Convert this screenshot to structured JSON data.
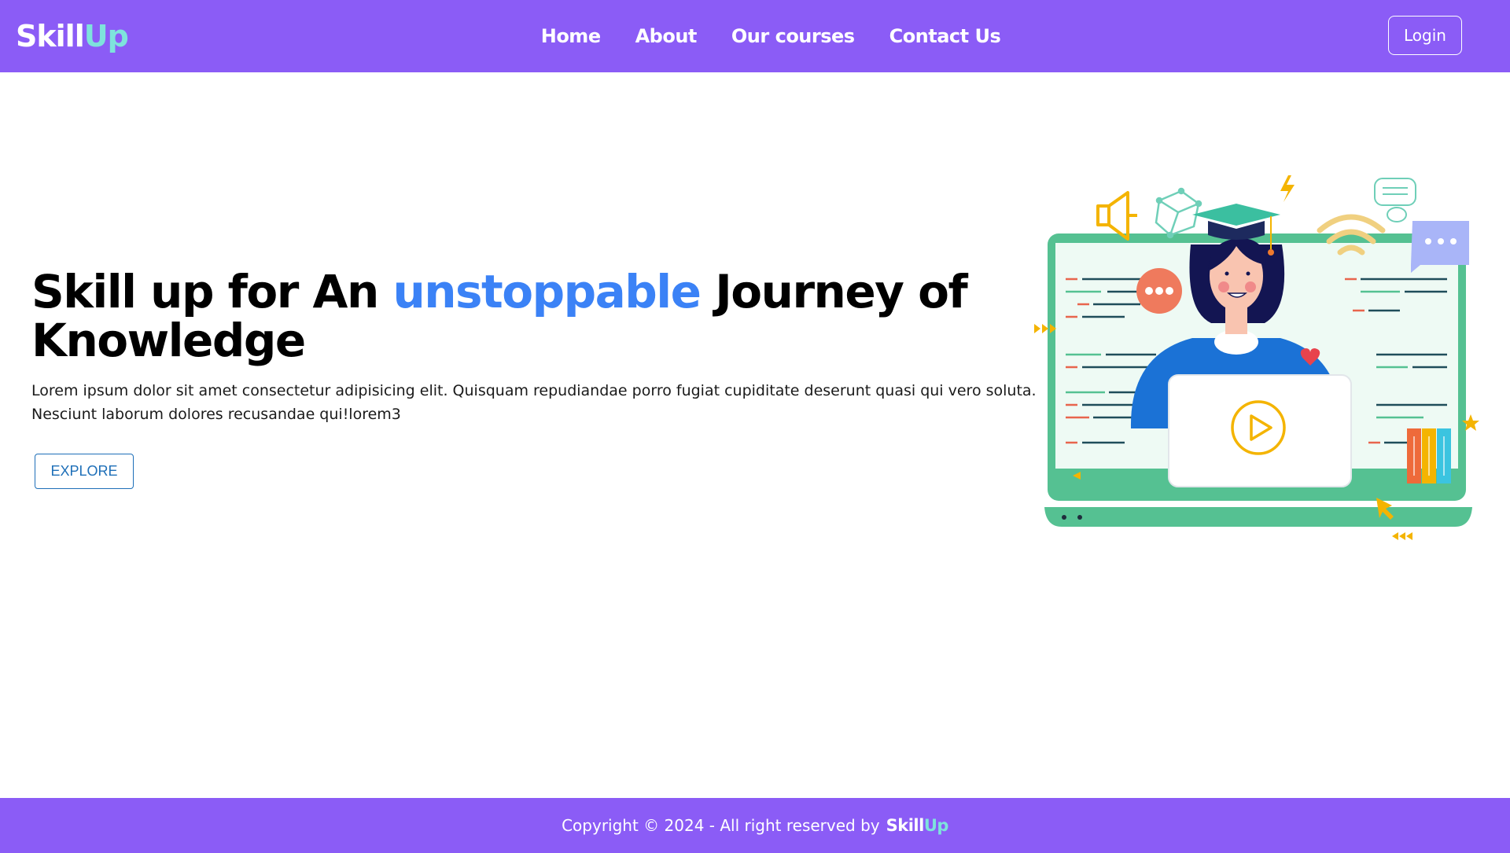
{
  "header": {
    "logo_main": "Skill",
    "logo_accent": "Up",
    "nav": [
      "Home",
      "About",
      "Our courses",
      "Contact Us"
    ],
    "login_label": "Login"
  },
  "hero": {
    "title_prefix": "Skill up for An ",
    "title_highlight": "unstoppable",
    "title_suffix": " Journey of Knowledge",
    "body": "Lorem ipsum dolor sit amet consectetur adipisicing elit. Quisquam repudiandae porro fugiat cupiditate deserunt quasi qui vero soluta. Nesciunt laborum dolores recusandae qui!lorem3",
    "explore_label": "EXPLORE"
  },
  "illustration": {
    "icons": [
      "megaphone-icon",
      "cube-icon",
      "lightning-icon",
      "wifi-icon",
      "speech-bubble-icon",
      "chat-bubble-icon",
      "graduate-avatar",
      "laptop-icon",
      "play-icon",
      "heart-icon",
      "books-icon",
      "cursor-icon",
      "star-icon"
    ]
  },
  "footer": {
    "copyright": "Copyright © 2024 - All right reserved by",
    "logo_main": "Skill",
    "logo_accent": "Up"
  },
  "colors": {
    "brand_purple": "#8b5cf6",
    "accent_teal": "#7ee3dc",
    "highlight_blue": "#3b82f6",
    "button_blue": "#1e6fb8"
  }
}
